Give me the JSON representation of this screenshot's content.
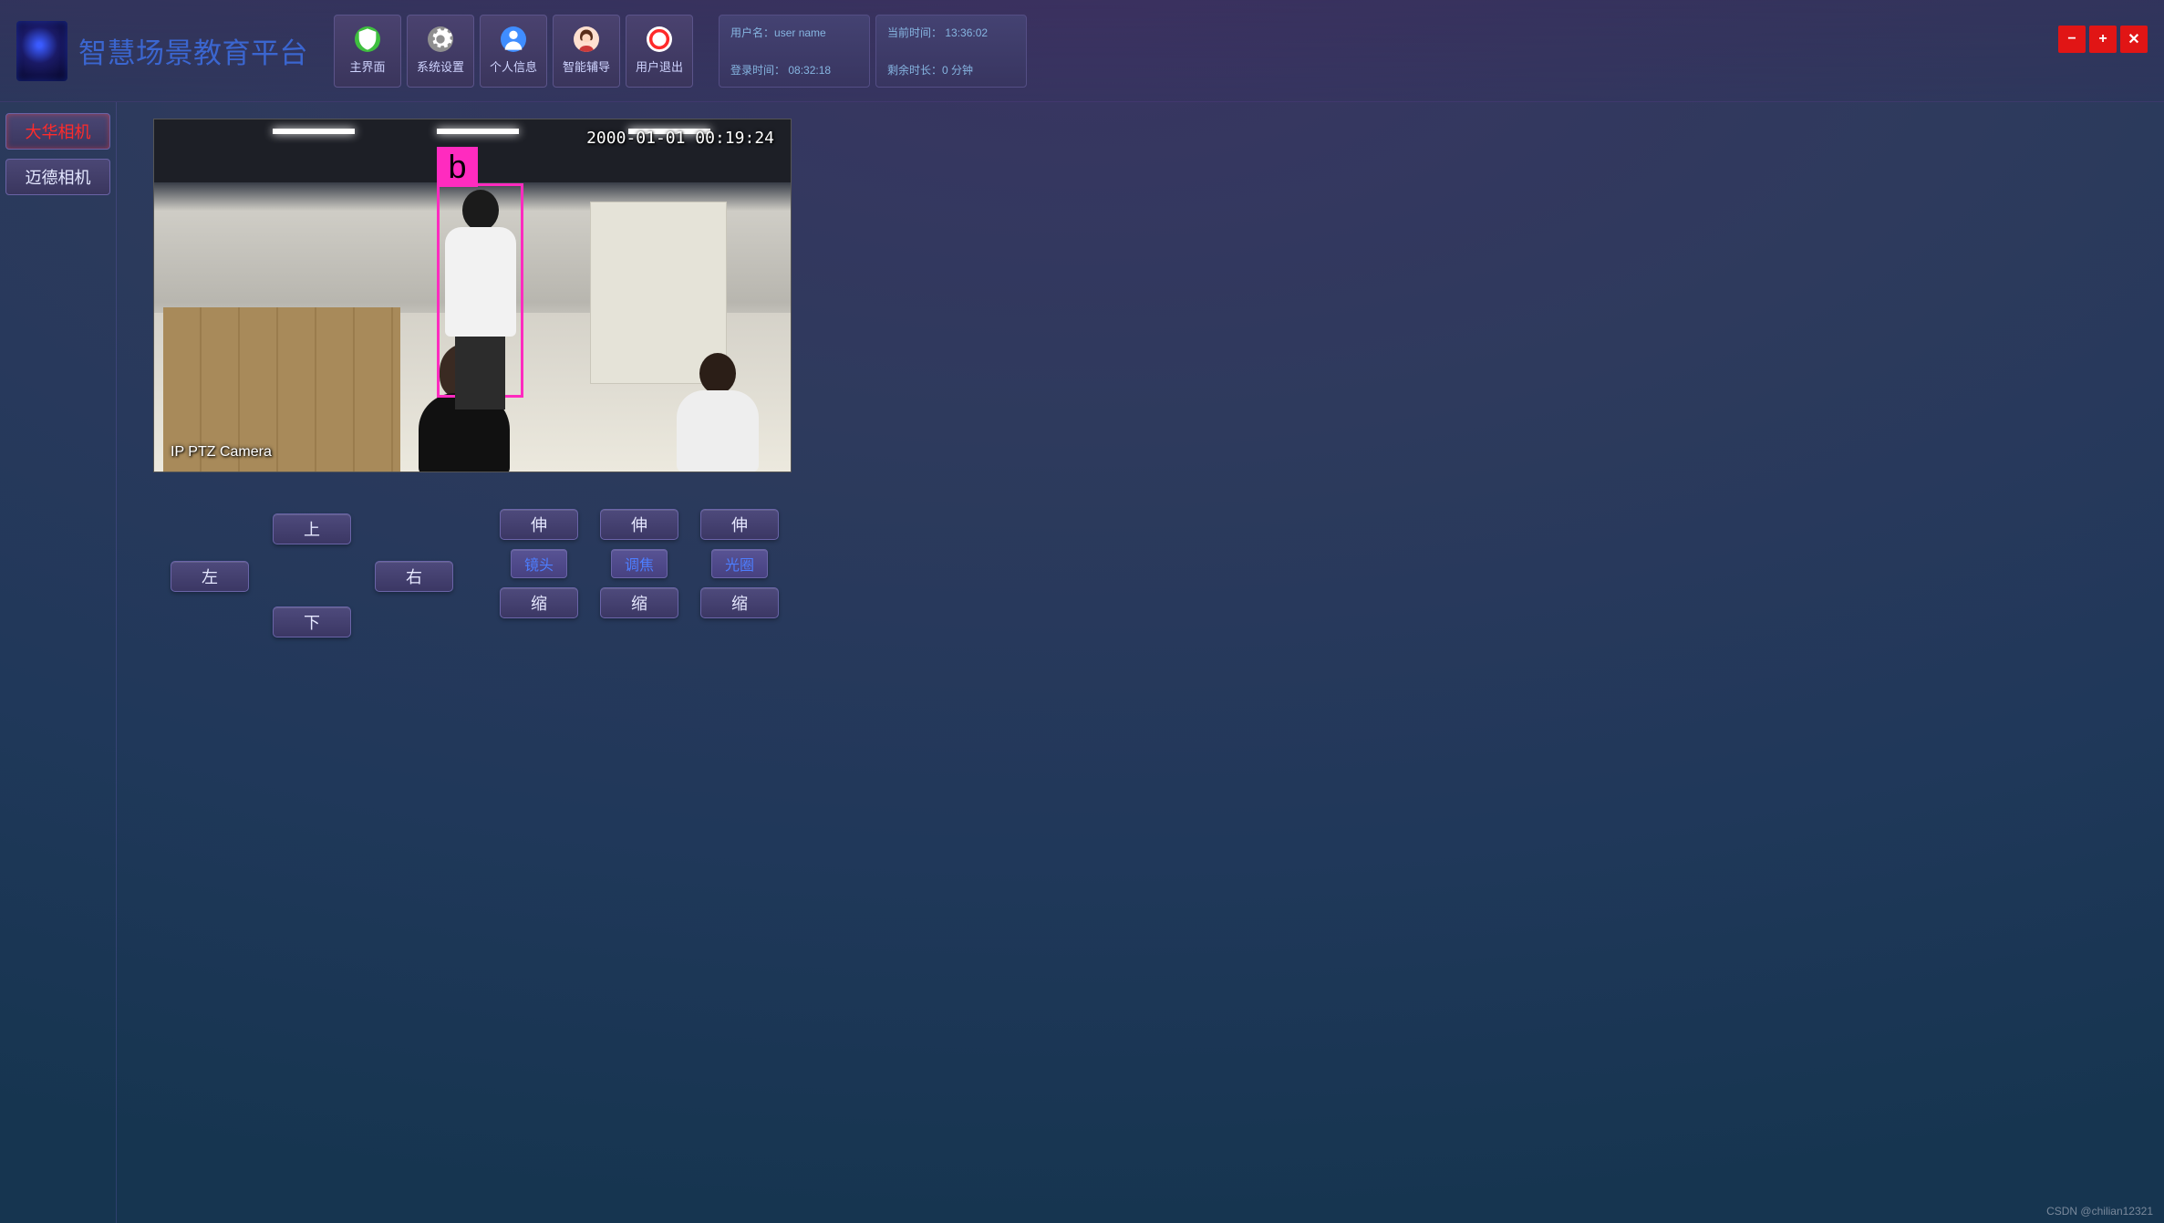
{
  "header": {
    "app_title": "智慧场景教育平台",
    "nav": [
      {
        "label": "主界面",
        "icon": "shield-icon",
        "icon_color": "#3fbf3f"
      },
      {
        "label": "系统设置",
        "icon": "gear-icon",
        "icon_color": "#b0b0b0"
      },
      {
        "label": "个人信息",
        "icon": "person-icon",
        "icon_color": "#3f8dff"
      },
      {
        "label": "智能辅导",
        "icon": "avatar-icon",
        "icon_color": "#ffb080"
      },
      {
        "label": "用户退出",
        "icon": "power-icon",
        "icon_color": "#ff3a3a"
      }
    ],
    "info": {
      "username_label": "用户名：",
      "username_value": "user name",
      "login_time_label": "登录时间：",
      "login_time_value": "08:32:18",
      "current_time_label": "当前时间：",
      "current_time_value": "13:36:02",
      "remaining_label": "剩余时长：",
      "remaining_value": "0 分钟"
    },
    "window_controls": {
      "minimize": "−",
      "maximize": "+",
      "close": "✕"
    }
  },
  "sidebar": {
    "tabs": [
      {
        "label": "大华相机",
        "active": true
      },
      {
        "label": "迈德相机",
        "active": false
      }
    ]
  },
  "video": {
    "timestamp": "2000-01-01 00:19:24",
    "camera_name": "IP PTZ Camera",
    "detection": {
      "label": "b"
    }
  },
  "ptz": {
    "dir": {
      "up": "上",
      "down": "下",
      "left": "左",
      "right": "右"
    },
    "groups": [
      {
        "label": "镜头",
        "extend": "伸",
        "shrink": "缩"
      },
      {
        "label": "调焦",
        "extend": "伸",
        "shrink": "缩"
      },
      {
        "label": "光圈",
        "extend": "伸",
        "shrink": "缩"
      }
    ]
  },
  "watermark": "CSDN @chilian12321"
}
